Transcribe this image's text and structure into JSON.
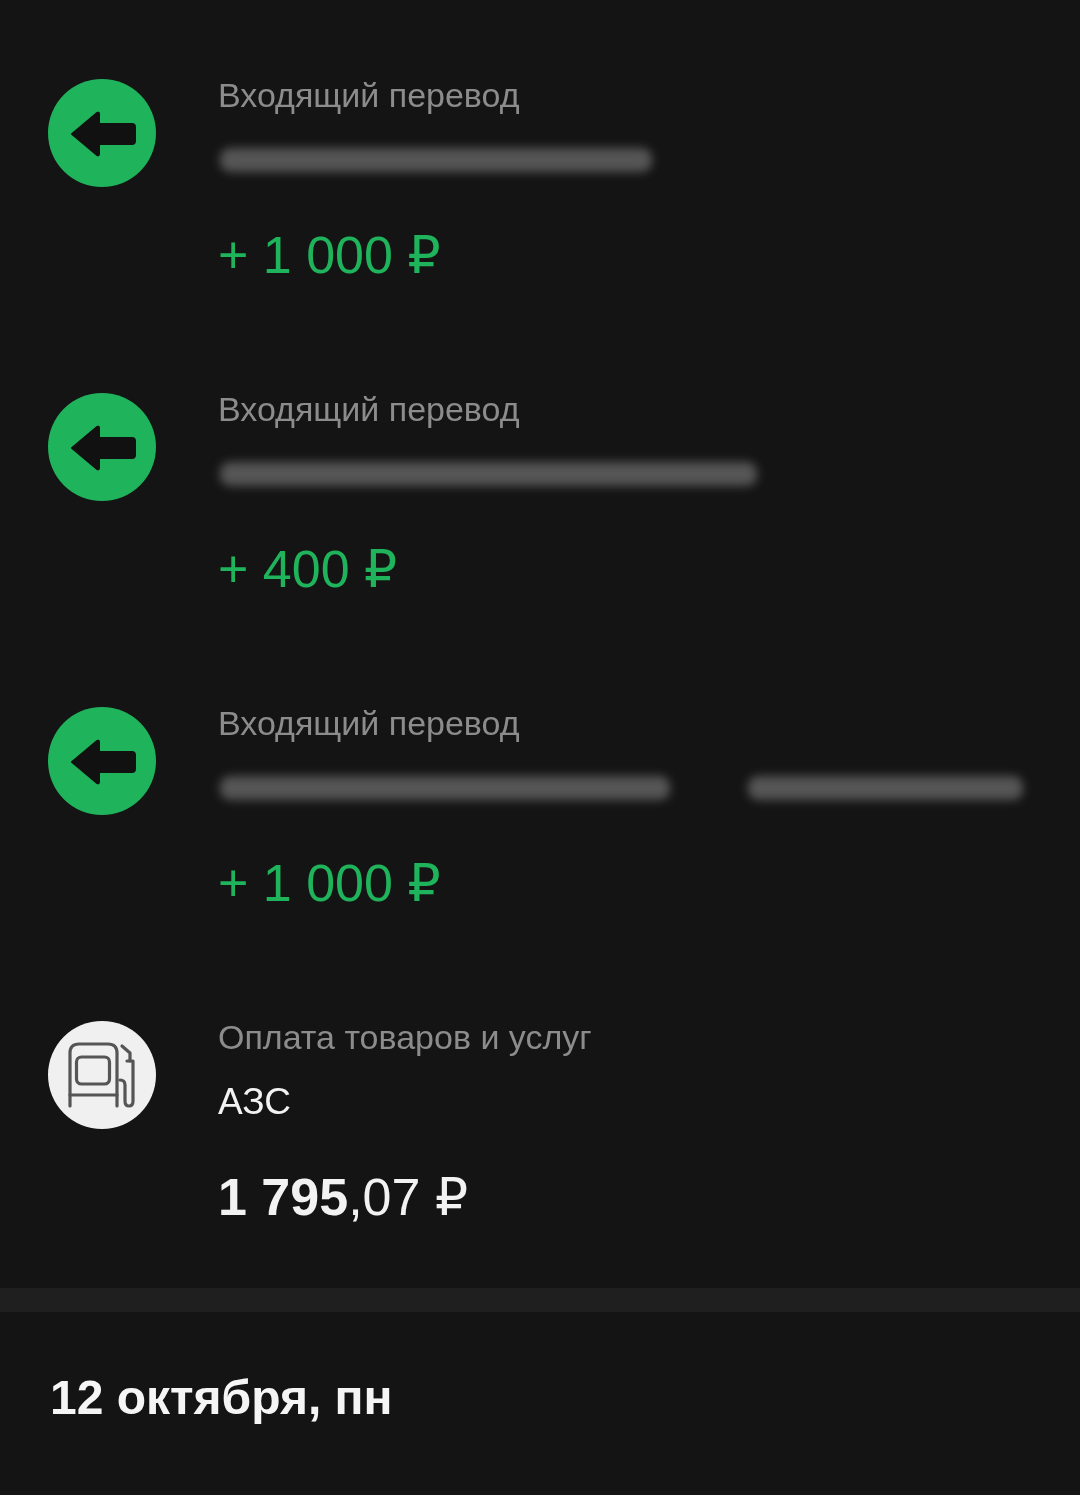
{
  "transactions": [
    {
      "kind": "incoming",
      "title": "Входящий перевод",
      "name_blurred": true,
      "amount": "+ 1 000 ₽"
    },
    {
      "kind": "incoming",
      "title": "Входящий перевод",
      "name_blurred": true,
      "amount": "+ 400 ₽"
    },
    {
      "kind": "incoming",
      "title": "Входящий перевод",
      "name_blurred": true,
      "amount": "+ 1 000 ₽"
    },
    {
      "kind": "payment",
      "title": "Оплата товаров и услуг",
      "name_blurred": false,
      "name": "АЗС",
      "amount": "**1 795**,07 ₽"
    }
  ],
  "date_header": "12 октября, пн"
}
